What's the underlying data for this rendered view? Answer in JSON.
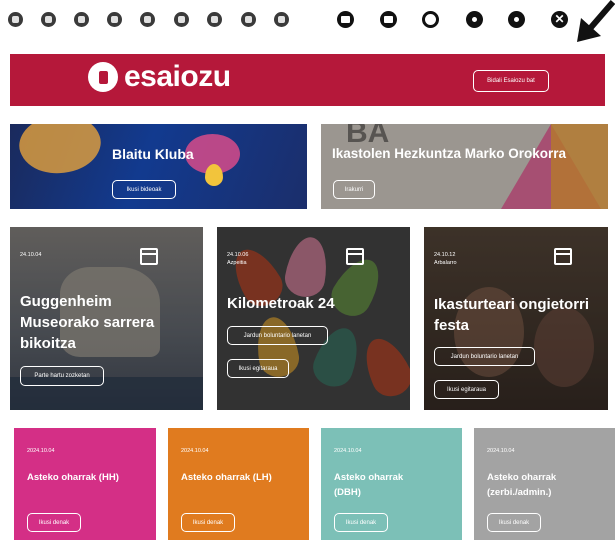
{
  "toolbar": {
    "left_icons": [
      "mic-icon",
      "sound-icon",
      "user-icon",
      "car-icon",
      "gauge-icon",
      "monitor-icon",
      "keyboard-icon",
      "phone-icon",
      "hand-icon"
    ],
    "right_icons": [
      "mail-icon",
      "document-icon",
      "circle-icon",
      "settings-icon",
      "globe-icon",
      "close-icon"
    ]
  },
  "banner": {
    "logo_text": "esaiozu",
    "button_label": "Bidali Esaiozu bat",
    "color": "#b5183a"
  },
  "features": [
    {
      "title": "Blaitu Kluba",
      "button": "Ikusi bideoak"
    },
    {
      "title": "Ikastolen Hezkuntza Marko Orokorra",
      "button": "Irakurri"
    }
  ],
  "events": [
    {
      "date": "24.10.04",
      "place": "",
      "title": "Guggenheim Museorako sarrera bikoitza",
      "buttons": [
        "Parte hartu zozketan"
      ]
    },
    {
      "date": "24.10.06",
      "place": "Azpeitia",
      "title": "Kilometroak 24",
      "buttons": [
        "Jardun boluntario lanetan",
        "Ikusi egitaraua"
      ]
    },
    {
      "date": "24.10.12",
      "place": "Arbalarro",
      "title": "Ikasturteari ongietorri festa",
      "buttons": [
        "Jardun boluntario lanetan",
        "Ikusi egitaraua"
      ]
    }
  ],
  "notes": [
    {
      "date": "2024.10.04",
      "title": "Asteko oharrak (HH)",
      "button": "Ikusi denak",
      "color": "#d42f86"
    },
    {
      "date": "2024.10.04",
      "title": "Asteko oharrak (LH)",
      "button": "Ikusi denak",
      "color": "#e07b1f"
    },
    {
      "date": "2024.10.04",
      "title": "Asteko oharrak (DBH)",
      "button": "Ikusi denak",
      "color": "#7cc0b7"
    },
    {
      "date": "2024.10.04",
      "title": "Asteko oharrak (zerbi./admin.)",
      "button": "Ikusi denak",
      "color": "#a3a3a3"
    }
  ]
}
